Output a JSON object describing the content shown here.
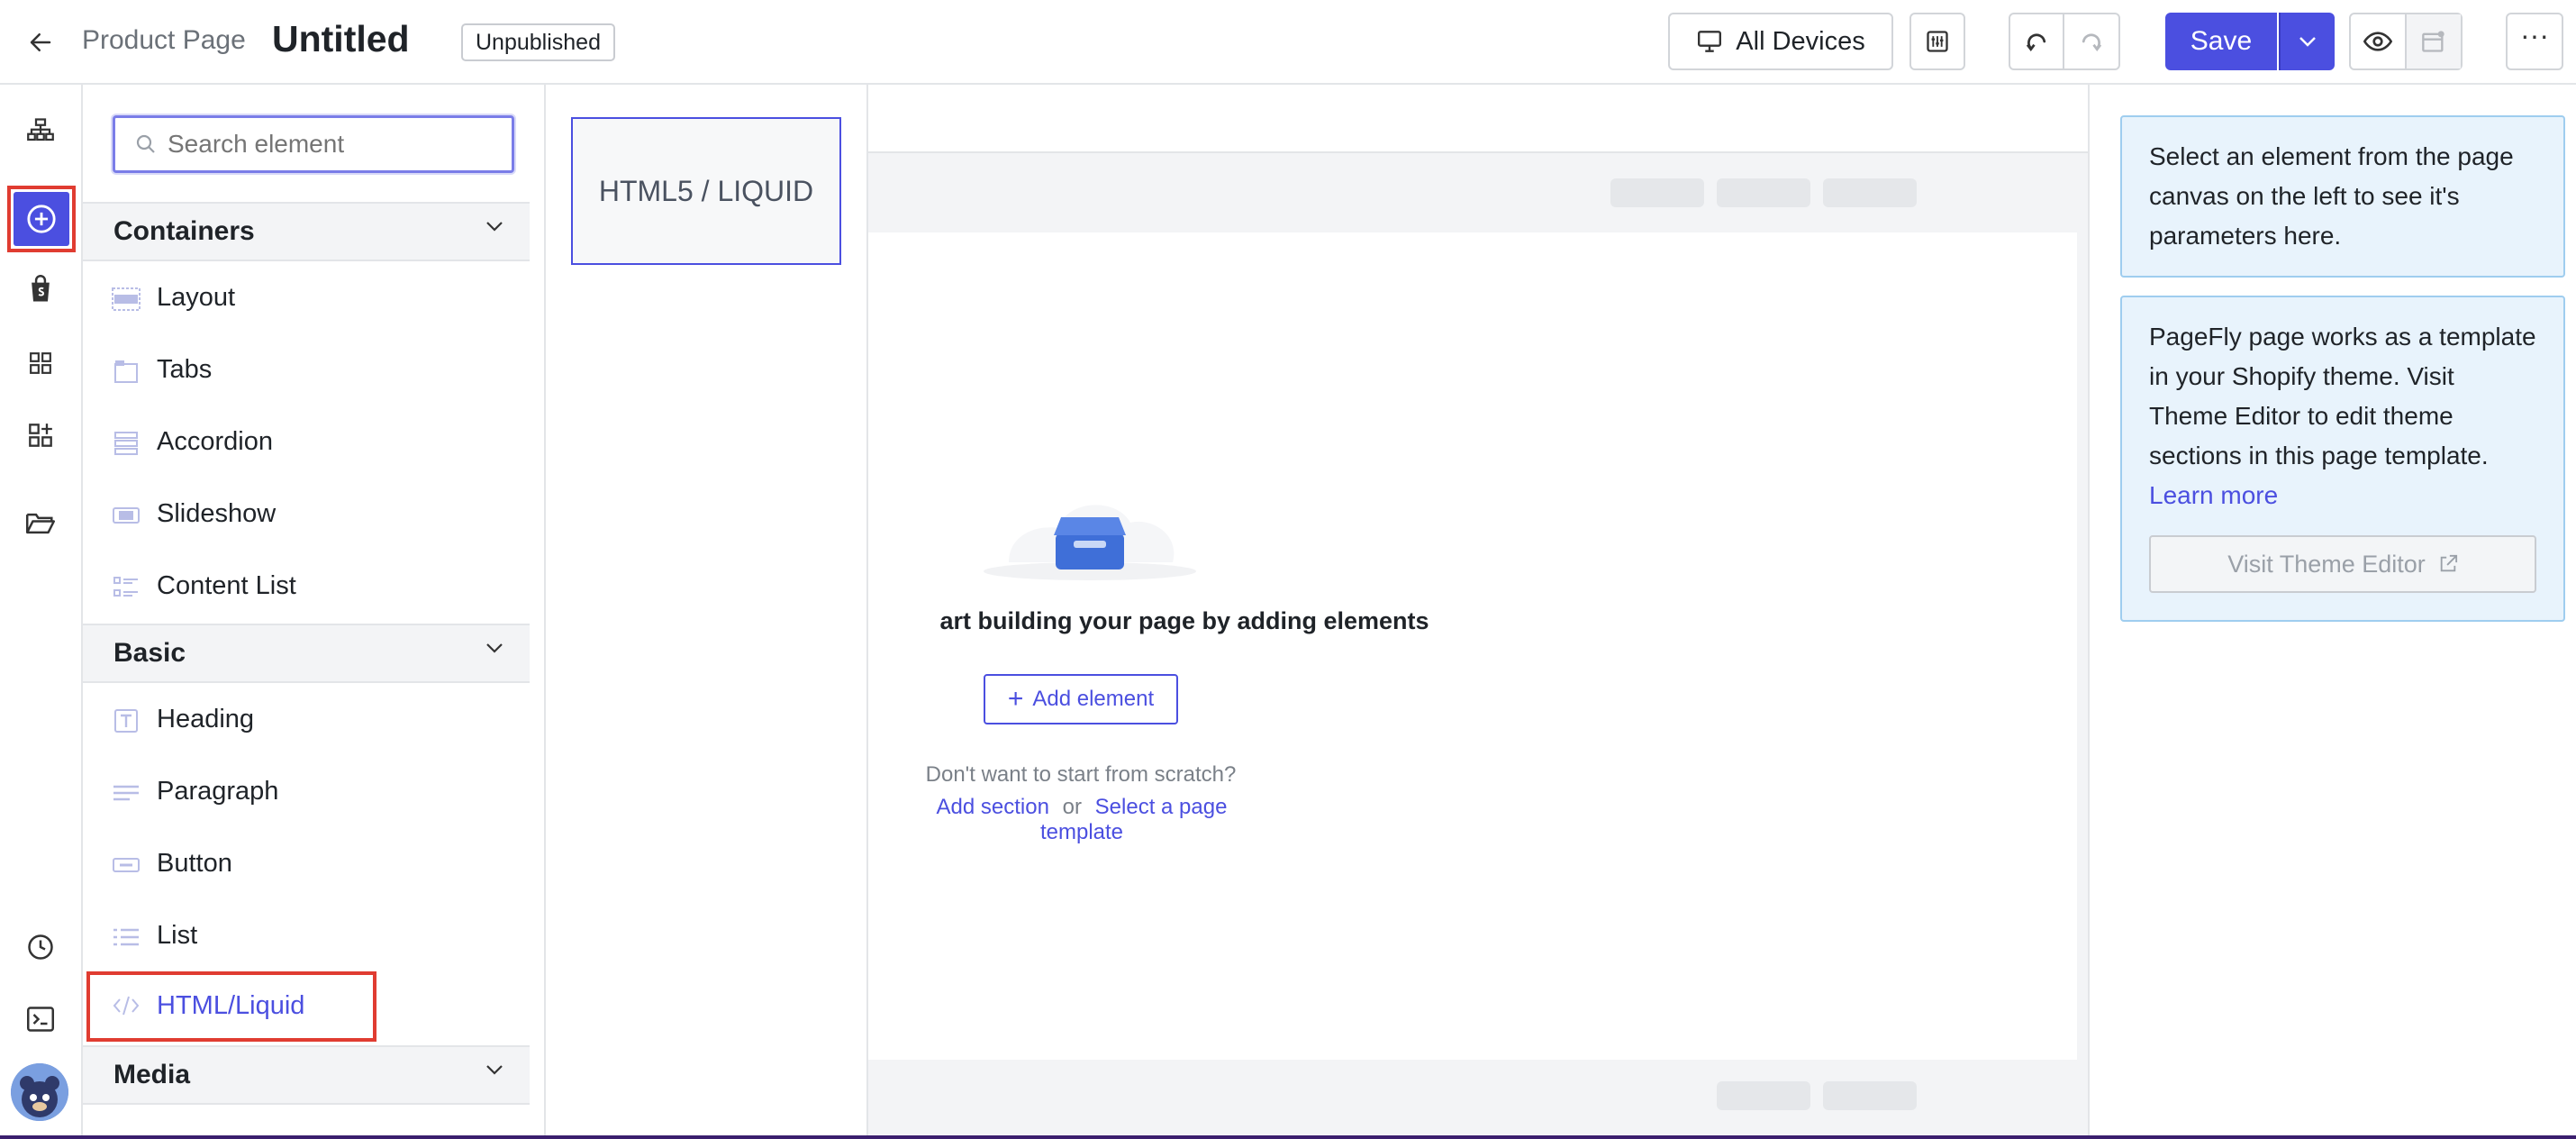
{
  "header": {
    "breadcrumb": "Product Page",
    "title": "Untitled",
    "status_badge": "Unpublished",
    "devices_label": "All Devices",
    "save_label": "Save"
  },
  "search": {
    "placeholder": "Search element"
  },
  "sections": [
    {
      "title": "Containers",
      "items": [
        "Layout",
        "Tabs",
        "Accordion",
        "Slideshow",
        "Content List"
      ]
    },
    {
      "title": "Basic",
      "items": [
        "Heading",
        "Paragraph",
        "Button",
        "List",
        "HTML/Liquid"
      ]
    },
    {
      "title": "Media",
      "items": []
    }
  ],
  "drag_preview": {
    "label": "HTML5 / LIQUID"
  },
  "canvas": {
    "empty_title": "art building your page by adding elements",
    "add_element": "Add element",
    "scratch_text": "Don't want to start from scratch?",
    "add_section": "Add section",
    "or": "or",
    "select_template": "Select a page template"
  },
  "right_panel": {
    "info1": "Select an element from the page canvas on the left to see it's parameters here.",
    "info2": "PageFly page works as a template in your Shopify theme. Visit Theme Editor to edit theme sections in this page template.",
    "learn_more": "Learn more",
    "visit_theme_editor": "Visit Theme Editor"
  },
  "colors": {
    "accent": "#4b4fe0",
    "highlight_red": "#e03c31",
    "info_bg": "#e8f3fc",
    "info_border": "#9fcdef"
  }
}
